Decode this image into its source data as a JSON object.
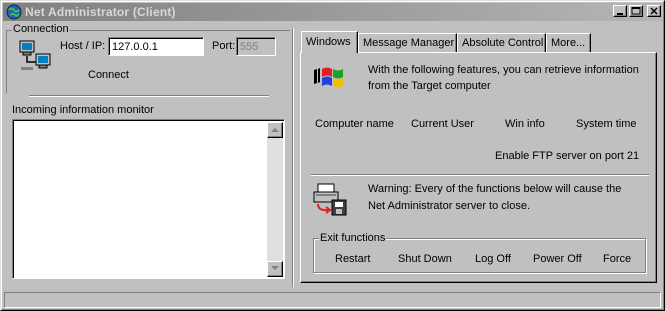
{
  "window": {
    "title": "Net Administrator (Client)"
  },
  "connection": {
    "group_label": "Connection",
    "host_label": "Host / IP:",
    "host_value": "127.0.0.1",
    "port_label": "Port:",
    "port_value": "555",
    "connect_label": "Connect"
  },
  "monitor": {
    "label": "Incoming information monitor"
  },
  "tabs": [
    {
      "label": "Windows"
    },
    {
      "label": "Message Manager"
    },
    {
      "label": "Absolute Control"
    },
    {
      "label": "More..."
    }
  ],
  "windows_tab": {
    "info_text_1": "With the following features, you can retrieve information",
    "info_text_2": "from the Target computer",
    "actions": [
      "Computer name",
      "Current User",
      "Win info",
      "System time"
    ],
    "ftp_label": "Enable FTP server on port 21",
    "warning_1": "Warning: Every of the functions below will cause the",
    "warning_2": "Net Administrator server to close.",
    "exit_group_label": "Exit functions",
    "exit_actions": [
      "Restart",
      "Shut Down",
      "Log Off",
      "Power Off",
      "Force"
    ]
  },
  "icons": {
    "title": "globe-icon",
    "connection": "network-computers-icon",
    "windows": "windows-logo-icon",
    "warning": "computer-shutdown-icon"
  }
}
